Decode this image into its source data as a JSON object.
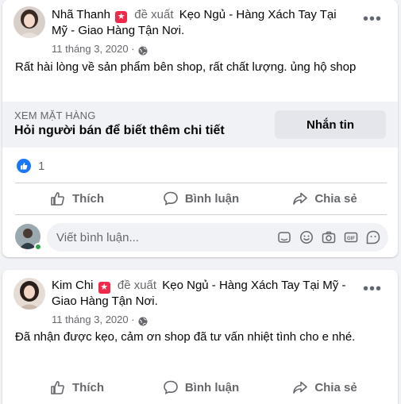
{
  "posts": [
    {
      "author": "Nhã Thanh",
      "badge": "★",
      "verb": "đề xuất",
      "target": "Kẹo Ngủ - Hàng Xách Tay Tại Mỹ - Giao Hàng Tận Nơi.",
      "date": "11 tháng 3, 2020 ·",
      "body": "Rất hài lòng về sản phẩm bên shop, rất chất lượng. ủng hộ shop",
      "more": "•••",
      "product": {
        "kicker": "XEM MẶT HÀNG",
        "title": "Hỏi người bán để biết thêm chi tiết",
        "button": "Nhắn tin"
      },
      "reaction_count": "1",
      "actions": {
        "like": "Thích",
        "comment": "Bình luận",
        "share": "Chia sẻ"
      },
      "comment_placeholder": "Viết bình luận..."
    },
    {
      "author": "Kim Chi",
      "badge": "★",
      "verb": "đề xuất",
      "target": "Kẹo Ngủ - Hàng Xách Tay Tại Mỹ - Giao Hàng Tận Nơi.",
      "date": "11 tháng 3, 2020 ·",
      "body": "Đã nhận được kẹo, cảm ơn shop đã tư vấn nhiệt tình cho e nhé.",
      "more": "•••",
      "actions": {
        "like": "Thích",
        "comment": "Bình luận",
        "share": "Chia sẻ"
      }
    }
  ],
  "icons": {
    "like": "thumbs-up-icon",
    "comment": "speech-bubble-icon",
    "share": "share-arrow-icon",
    "privacy": "globe-icon",
    "comment_tools": [
      "sticker-icon",
      "emoji-icon",
      "camera-icon",
      "gif-icon",
      "avatar-sticker-icon"
    ]
  },
  "colors": {
    "accent": "#1877f2",
    "badge": "#f0284a",
    "online": "#31a24c"
  }
}
